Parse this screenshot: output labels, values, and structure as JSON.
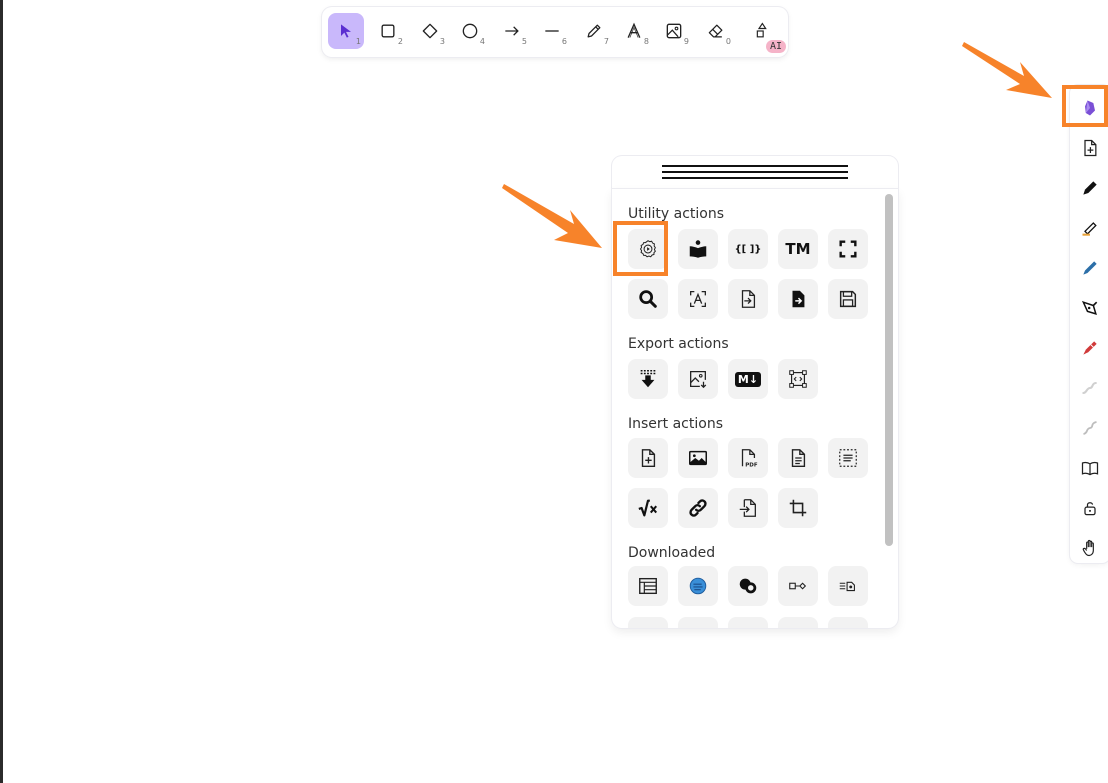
{
  "toolbar": {
    "tools": [
      {
        "name": "selection",
        "key": "1",
        "icon": "pointer-icon",
        "active": true
      },
      {
        "name": "rectangle",
        "key": "2",
        "icon": "rectangle-icon"
      },
      {
        "name": "diamond",
        "key": "3",
        "icon": "diamond-icon"
      },
      {
        "name": "ellipse",
        "key": "4",
        "icon": "circle-icon"
      },
      {
        "name": "arrow",
        "key": "5",
        "icon": "arrow-icon"
      },
      {
        "name": "line",
        "key": "6",
        "icon": "line-icon"
      },
      {
        "name": "draw",
        "key": "7",
        "icon": "pencil-icon"
      },
      {
        "name": "text",
        "key": "8",
        "icon": "text-icon"
      },
      {
        "name": "image",
        "key": "9",
        "icon": "image-icon"
      },
      {
        "name": "eraser",
        "key": "0",
        "icon": "eraser-icon"
      },
      {
        "name": "ai-shapes",
        "key": "",
        "icon": "shapes-icon",
        "badge": "AI"
      }
    ]
  },
  "panel": {
    "sections": {
      "utility": "Utility actions",
      "export": "Export actions",
      "insert": "Insert actions",
      "downloaded": "Downloaded"
    },
    "text_icons": {
      "brackets": "{[ ]}",
      "tm": "TM",
      "md": "M↓"
    }
  },
  "sidebar": {
    "items": [
      "obsidian-icon",
      "new-file-icon",
      "pen-icon",
      "highlighter-icon",
      "marker-icon",
      "fountain-pen-icon",
      "red-marker-icon",
      "squiggle-light-icon",
      "squiggle-icon",
      "book-icon",
      "lock-icon",
      "hand-icon"
    ]
  },
  "colors": {
    "accent": "#c9b8fb",
    "highlight": "#f7832a",
    "obsidian_purple": "#7a4fd6",
    "marker_blue": "#2c6fa8",
    "marker_red": "#d03a3a"
  }
}
